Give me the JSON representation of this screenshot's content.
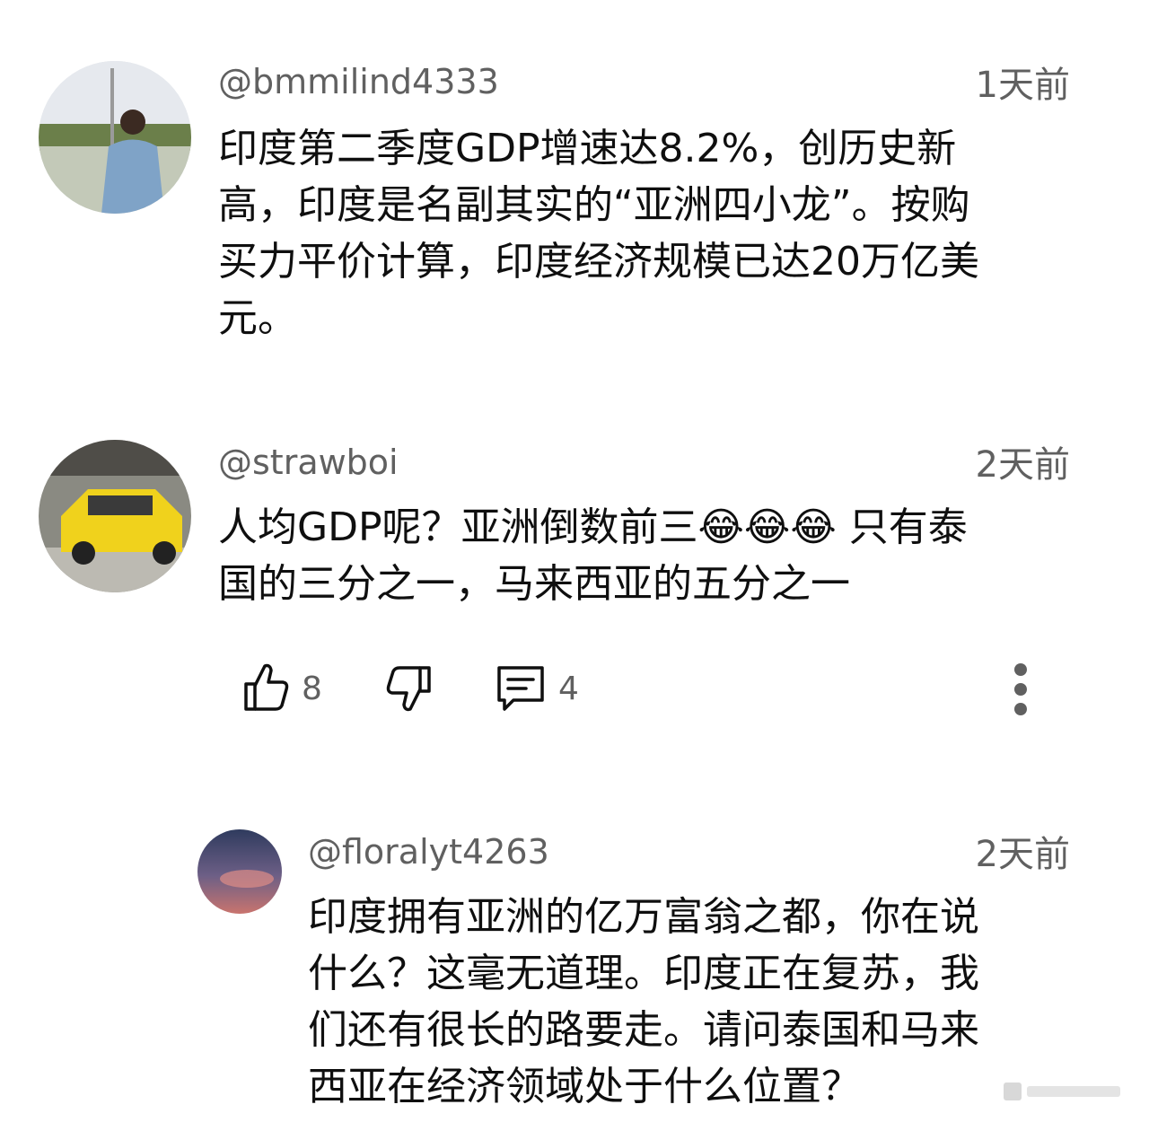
{
  "comments": [
    {
      "handle": "@bmmilind4333",
      "time": "1天前",
      "text": "印度第二季度GDP增速达8.2%，创历史新\n高，印度是名副其实的“亚洲四小龙”。按购\n买力平价计算，印度经济规模已达20万亿美\n元。"
    },
    {
      "handle": "@strawboi",
      "time": "2天前",
      "text": "人均GDP呢？亚洲倒数前三😂😂😂 只有泰\n国的三分之一，马来西亚的五分之一",
      "likes": "8",
      "replies": "4"
    },
    {
      "handle": "@floralyt4263",
      "time": "2天前",
      "text": "印度拥有亚洲的亿万富翁之都，你在说\n什么？这毫无道理。印度正在复苏，我\n们还有很长的路要走。请问泰国和马来\n西亚在经济领域处于什么位置？"
    }
  ],
  "icons": {
    "like": "thumbs-up-icon",
    "dislike": "thumbs-down-icon",
    "reply": "comment-icon",
    "more": "more-vertical-icon"
  }
}
